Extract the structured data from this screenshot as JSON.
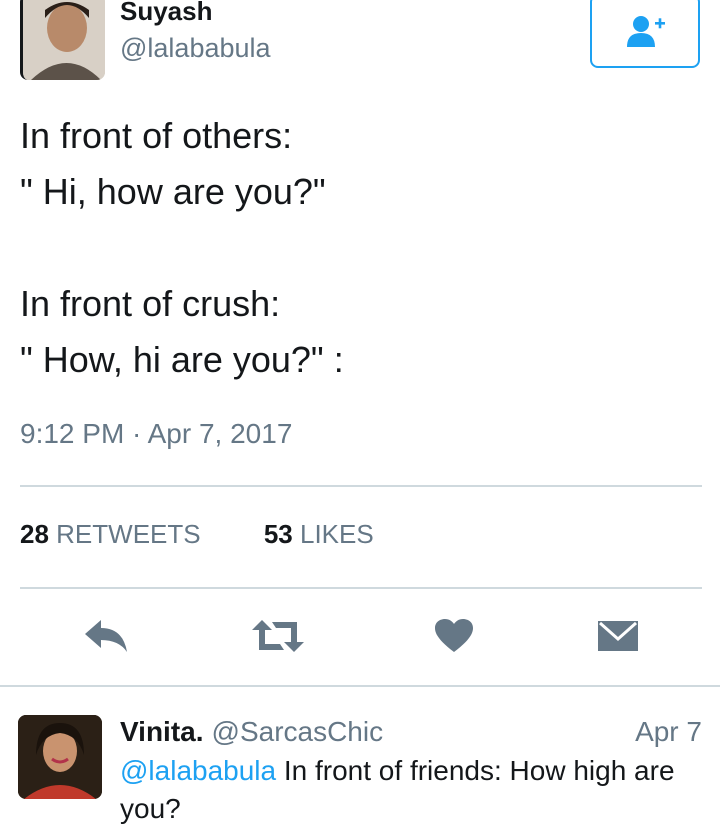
{
  "tweet": {
    "author_name": "Suyash",
    "author_handle": "@lalababula",
    "lines": [
      "In front of others:",
      "\" Hi, how are you?\"",
      "In front of crush:",
      "\" How, hi are you?\" :"
    ],
    "timestamp": "9:12 PM · Apr 7, 2017",
    "retweet_count": "28",
    "retweet_label": "RETWEETS",
    "like_count": "53",
    "like_label": "LIKES"
  },
  "icons": {
    "follow": "add-user-icon",
    "reply": "reply-icon",
    "retweet": "retweet-icon",
    "like": "heart-icon",
    "dm": "envelope-icon"
  },
  "colors": {
    "accent": "#1da1f2",
    "icon_gray": "#657786",
    "divider": "#cfd9de",
    "text": "#14171a"
  },
  "reply": {
    "name": "Vinita.",
    "handle": "@SarcasChic",
    "date": "Apr 7",
    "mention": "@lalababula",
    "text": " In front of friends: How high are you?"
  }
}
